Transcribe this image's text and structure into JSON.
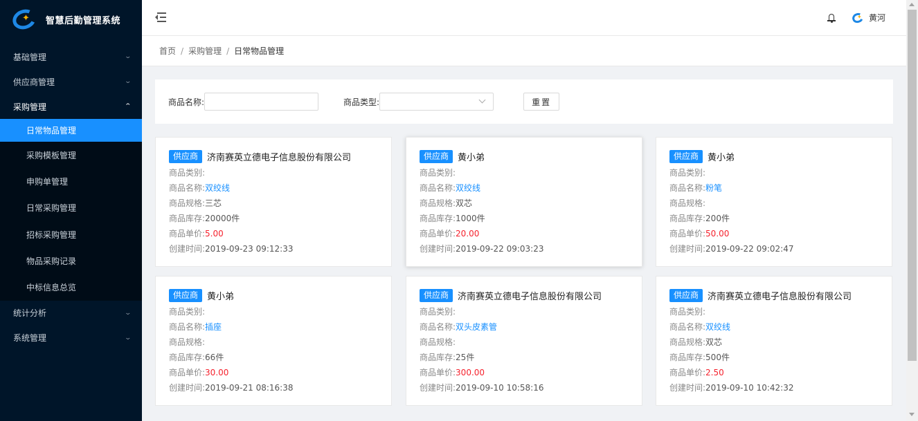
{
  "app": {
    "title": "智慧后勤管理系统"
  },
  "sidebar": {
    "items": [
      {
        "label": "基础管理",
        "expanded": false
      },
      {
        "label": "供应商管理",
        "expanded": false
      },
      {
        "label": "采购管理",
        "expanded": true,
        "children": [
          {
            "label": "日常物品管理",
            "active": true
          },
          {
            "label": "采购模板管理"
          },
          {
            "label": "申购单管理"
          },
          {
            "label": "日常采购管理"
          },
          {
            "label": "招标采购管理"
          },
          {
            "label": "物品采购记录"
          },
          {
            "label": "中标信息总览"
          }
        ]
      },
      {
        "label": "统计分析",
        "expanded": false
      },
      {
        "label": "系统管理",
        "expanded": false
      }
    ]
  },
  "header": {
    "user_name": "黄河",
    "icons": [
      "menu-fold-icon",
      "bell-icon"
    ]
  },
  "breadcrumb": [
    "首页",
    "采购管理",
    "日常物品管理"
  ],
  "filter": {
    "name_label": "商品名称:",
    "name_value": "",
    "type_label": "商品类型:",
    "type_value": "",
    "reset_label": "重置"
  },
  "labels": {
    "badge": "供应商",
    "category": "商品类别:",
    "name": "商品名称:",
    "spec": "商品规格:",
    "stock": "商品库存:",
    "price": "商品单价:",
    "created": "创建时间:"
  },
  "cards": [
    {
      "supplier": "济南赛英立德电子信息股份有限公司",
      "category": "",
      "name": "双绞线",
      "spec": "三芯",
      "stock": "20000件",
      "price": "5.00",
      "created": "2019-09-23 09:12:33"
    },
    {
      "supplier": "黄小弟",
      "category": "",
      "name": "双绞线",
      "spec": "双芯",
      "stock": "1000件",
      "price": "20.00",
      "created": "2019-09-22 09:03:23"
    },
    {
      "supplier": "黄小弟",
      "category": "",
      "name": "粉笔",
      "spec": "",
      "stock": "200件",
      "price": "50.00",
      "created": "2019-09-22 09:02:47"
    },
    {
      "supplier": "黄小弟",
      "category": "",
      "name": "插座",
      "spec": "",
      "stock": "66件",
      "price": "30.00",
      "created": "2019-09-21 08:16:38"
    },
    {
      "supplier": "济南赛英立德电子信息股份有限公司",
      "category": "",
      "name": "双头皮素管",
      "spec": "",
      "stock": "25件",
      "price": "300.00",
      "created": "2019-09-10 10:58:16"
    },
    {
      "supplier": "济南赛英立德电子信息股份有限公司",
      "category": "",
      "name": "双绞线",
      "spec": "双芯",
      "stock": "500件",
      "price": "2.50",
      "created": "2019-09-10 10:42:32"
    }
  ],
  "colors": {
    "sidebar_bg": "#001529",
    "accent": "#1890ff",
    "price": "#f5222d"
  }
}
